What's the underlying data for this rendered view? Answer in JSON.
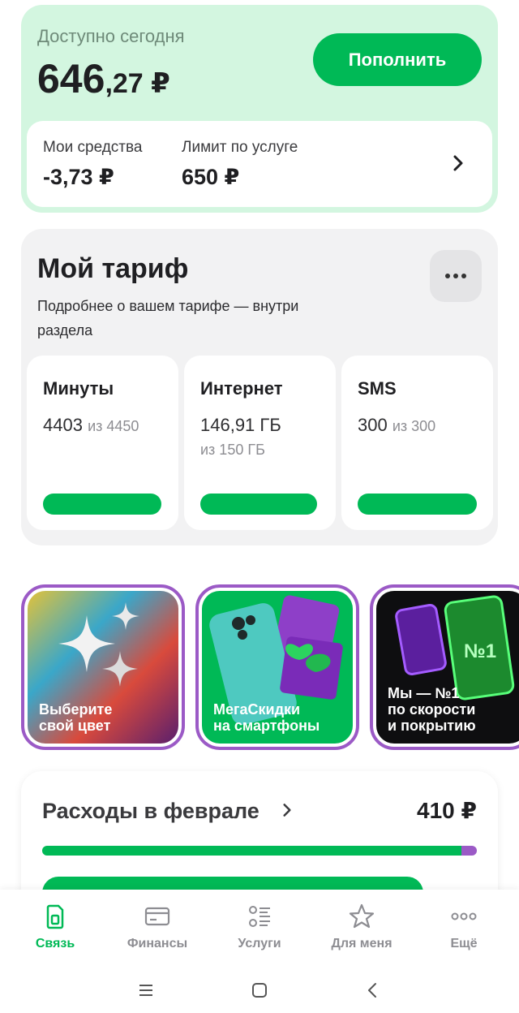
{
  "balance": {
    "title": "Доступно сегодня",
    "amount_int": "646",
    "amount_dec": ",27 ₽",
    "topup_label": "Пополнить",
    "my_funds_label": "Мои средства",
    "my_funds_value": "-3,73 ₽",
    "limit_label": "Лимит по услуге",
    "limit_value": "650 ₽"
  },
  "tariff": {
    "title": "Мой тариф",
    "subtitle": "Подробнее о вашем тарифе — внутри раздела",
    "packages": [
      {
        "title": "Минуты",
        "value": "4403",
        "of": "из 4450",
        "fill": 0.99
      },
      {
        "title": "Интернет",
        "value": "146,91 ГБ",
        "of": "из 150 ГБ",
        "fill": 0.98
      },
      {
        "title": "SMS",
        "value": "300",
        "of": "из 300",
        "fill": 1.0
      }
    ]
  },
  "stories": [
    {
      "line1": "Выберите",
      "line2": "свой цвет"
    },
    {
      "line1": "МегаСкидки",
      "line2": "на смартфоны"
    },
    {
      "line1": "Мы — №1",
      "line2": "по скорости",
      "line3": "и покрытию"
    }
  ],
  "expenses": {
    "title": "Расходы в феврале",
    "amount": "410 ₽",
    "green_share": 0.965
  },
  "nav": [
    {
      "label": "Связь",
      "icon": "sim-icon",
      "active": true
    },
    {
      "label": "Финансы",
      "icon": "card-icon",
      "active": false
    },
    {
      "label": "Услуги",
      "icon": "services-list-icon",
      "active": false
    },
    {
      "label": "Для меня",
      "icon": "star-icon",
      "active": false
    },
    {
      "label": "Ещё",
      "icon": "more-dots-icon",
      "active": false
    }
  ],
  "colors": {
    "accent": "#00b956",
    "balance_bg": "#d3f6e0",
    "story_border": "#9b5ac6"
  }
}
